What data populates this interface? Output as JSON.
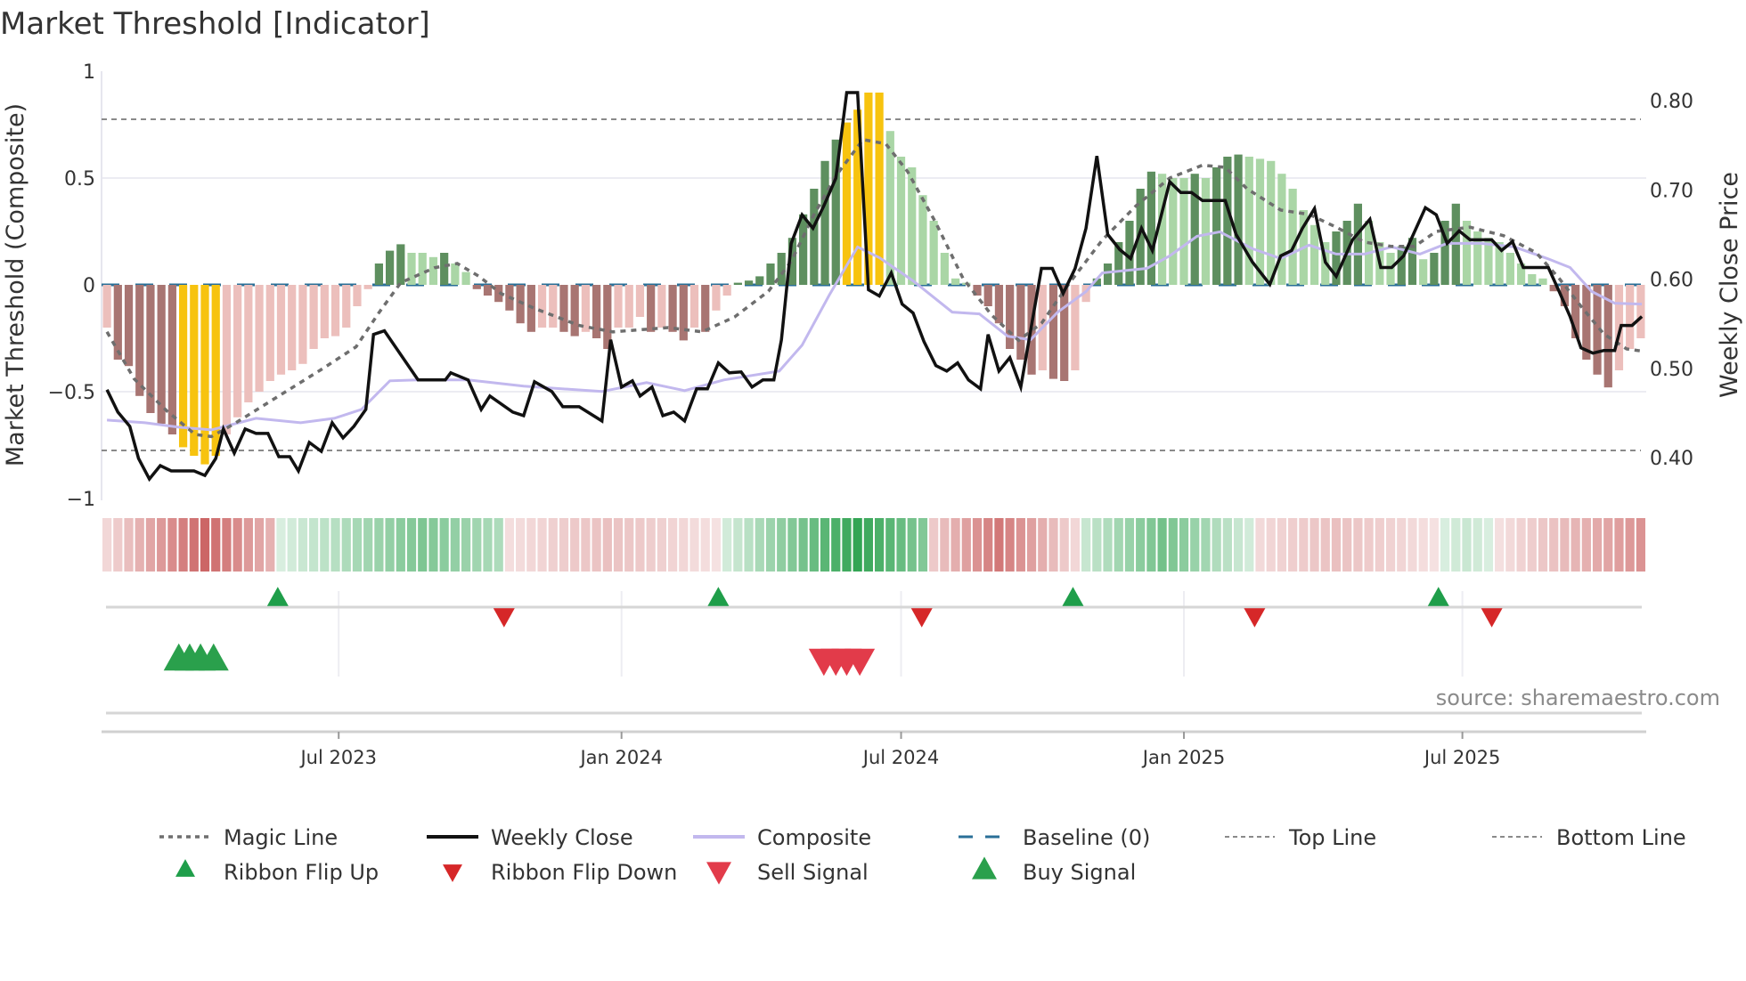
{
  "chart_data": {
    "type": "bar",
    "title": "Market Threshold [Indicator]",
    "ylabel": "Market Threshold (Composite)",
    "y2label": "Weekly Close Price",
    "ylim": [
      -1,
      1
    ],
    "y2lim": [
      0.4,
      0.8
    ],
    "yticks": [
      {
        "v": 1,
        "label": "1"
      },
      {
        "v": 0.5,
        "label": "0.5"
      },
      {
        "v": 0,
        "label": "0"
      },
      {
        "v": -0.5,
        "label": "−0.5"
      },
      {
        "v": -1,
        "label": "−1"
      }
    ],
    "y2ticks": [
      {
        "v": 0.8,
        "label": "0.80"
      },
      {
        "v": 0.7,
        "label": "0.70"
      },
      {
        "v": 0.6,
        "label": "0.60"
      },
      {
        "v": 0.5,
        "label": "0.50"
      },
      {
        "v": 0.4,
        "label": "0.40"
      }
    ],
    "x_unit": "week index",
    "n_weeks": 142,
    "xticks": [
      {
        "week": 21.8,
        "label": "Jul 2023"
      },
      {
        "week": 47.8,
        "label": "Jan 2024"
      },
      {
        "week": 73.5,
        "label": "Jul 2024"
      },
      {
        "week": 99.5,
        "label": "Jan 2025"
      },
      {
        "week": 125.1,
        "label": "Jul 2025"
      }
    ],
    "top_line": 0.775,
    "bottom_line": -0.775,
    "baseline": 0,
    "grid": true,
    "legend_position": "bottom",
    "composite_bars": [
      -0.2,
      -0.35,
      -0.38,
      -0.52,
      -0.6,
      -0.65,
      -0.7,
      -0.76,
      -0.8,
      -0.84,
      -0.8,
      -0.7,
      -0.62,
      -0.55,
      -0.5,
      -0.45,
      -0.42,
      -0.4,
      -0.37,
      -0.3,
      -0.25,
      -0.24,
      -0.2,
      -0.1,
      -0.02,
      0.1,
      0.16,
      0.19,
      0.15,
      0.15,
      0.13,
      0.15,
      0.1,
      0.06,
      -0.02,
      -0.05,
      -0.08,
      -0.12,
      -0.18,
      -0.22,
      -0.2,
      -0.2,
      -0.22,
      -0.24,
      -0.22,
      -0.25,
      -0.3,
      -0.2,
      -0.2,
      -0.15,
      -0.22,
      -0.2,
      -0.22,
      -0.26,
      -0.2,
      -0.22,
      -0.12,
      -0.05,
      0.01,
      0.02,
      0.04,
      0.1,
      0.15,
      0.22,
      0.33,
      0.45,
      0.58,
      0.68,
      0.76,
      0.82,
      0.9,
      0.9,
      0.72,
      0.6,
      0.55,
      0.42,
      0.3,
      0.15,
      0.03,
      0.01,
      -0.05,
      -0.1,
      -0.18,
      -0.3,
      -0.35,
      -0.42,
      -0.4,
      -0.44,
      -0.45,
      -0.4,
      -0.08,
      0.03,
      0.1,
      0.2,
      0.3,
      0.45,
      0.53,
      0.52,
      0.5,
      0.5,
      0.52,
      0.5,
      0.55,
      0.6,
      0.61,
      0.6,
      0.59,
      0.58,
      0.52,
      0.45,
      0.35,
      0.28,
      0.2,
      0.25,
      0.3,
      0.38,
      0.3,
      0.2,
      0.15,
      0.18,
      0.22,
      0.12,
      0.15,
      0.3,
      0.38,
      0.3,
      0.25,
      0.22,
      0.2,
      0.15,
      0.1,
      0.05,
      0.03,
      -0.03,
      -0.1,
      -0.25,
      -0.35,
      -0.42,
      -0.48,
      -0.4,
      -0.3,
      -0.25
    ],
    "weekly_close": [
      [
        0.5,
        0.476
      ],
      [
        1.5,
        0.451
      ],
      [
        2.6,
        0.435
      ],
      [
        3.4,
        0.399
      ],
      [
        4.4,
        0.376
      ],
      [
        5.4,
        0.391
      ],
      [
        6.4,
        0.385
      ],
      [
        8.5,
        0.385
      ],
      [
        9.5,
        0.38
      ],
      [
        10.5,
        0.399
      ],
      [
        11.2,
        0.432
      ],
      [
        12.2,
        0.405
      ],
      [
        13.2,
        0.432
      ],
      [
        14.2,
        0.427
      ],
      [
        15.3,
        0.427
      ],
      [
        16.3,
        0.401
      ],
      [
        17.3,
        0.401
      ],
      [
        18.1,
        0.385
      ],
      [
        19.1,
        0.417
      ],
      [
        20.2,
        0.407
      ],
      [
        21.2,
        0.439
      ],
      [
        22.2,
        0.422
      ],
      [
        23.2,
        0.435
      ],
      [
        24.3,
        0.454
      ],
      [
        25.0,
        0.538
      ],
      [
        26.0,
        0.542
      ],
      [
        29.1,
        0.487
      ],
      [
        31.6,
        0.487
      ],
      [
        32.1,
        0.495
      ],
      [
        33.7,
        0.487
      ],
      [
        34.9,
        0.454
      ],
      [
        35.7,
        0.469
      ],
      [
        37.8,
        0.451
      ],
      [
        38.8,
        0.447
      ],
      [
        39.8,
        0.485
      ],
      [
        41.4,
        0.474
      ],
      [
        42.4,
        0.457
      ],
      [
        43.9,
        0.457
      ],
      [
        46.0,
        0.441
      ],
      [
        46.8,
        0.532
      ],
      [
        47.8,
        0.479
      ],
      [
        48.8,
        0.486
      ],
      [
        49.5,
        0.469
      ],
      [
        50.6,
        0.479
      ],
      [
        51.6,
        0.447
      ],
      [
        52.6,
        0.451
      ],
      [
        53.6,
        0.441
      ],
      [
        54.7,
        0.477
      ],
      [
        55.7,
        0.477
      ],
      [
        56.7,
        0.506
      ],
      [
        57.7,
        0.495
      ],
      [
        58.8,
        0.496
      ],
      [
        59.8,
        0.479
      ],
      [
        60.8,
        0.487
      ],
      [
        61.8,
        0.487
      ],
      [
        62.5,
        0.532
      ],
      [
        63.4,
        0.64
      ],
      [
        64.4,
        0.672
      ],
      [
        65.4,
        0.657
      ],
      [
        66.4,
        0.682
      ],
      [
        67.5,
        0.713
      ],
      [
        68.5,
        0.809
      ],
      [
        69.5,
        0.809
      ],
      [
        70.5,
        0.588
      ],
      [
        71.5,
        0.581
      ],
      [
        72.6,
        0.607
      ],
      [
        73.6,
        0.572
      ],
      [
        74.6,
        0.562
      ],
      [
        75.6,
        0.53
      ],
      [
        76.7,
        0.503
      ],
      [
        77.7,
        0.497
      ],
      [
        78.7,
        0.506
      ],
      [
        79.7,
        0.487
      ],
      [
        80.8,
        0.477
      ],
      [
        81.5,
        0.538
      ],
      [
        82.5,
        0.497
      ],
      [
        83.5,
        0.512
      ],
      [
        84.5,
        0.479
      ],
      [
        86.4,
        0.612
      ],
      [
        87.4,
        0.612
      ],
      [
        88.4,
        0.584
      ],
      [
        89.5,
        0.612
      ],
      [
        90.5,
        0.657
      ],
      [
        91.5,
        0.738
      ],
      [
        92.5,
        0.65
      ],
      [
        93.6,
        0.633
      ],
      [
        94.6,
        0.623
      ],
      [
        95.6,
        0.657
      ],
      [
        96.6,
        0.632
      ],
      [
        98.2,
        0.709
      ],
      [
        99.2,
        0.697
      ],
      [
        100.2,
        0.697
      ],
      [
        101.2,
        0.688
      ],
      [
        103.3,
        0.688
      ],
      [
        104.3,
        0.65
      ],
      [
        105.8,
        0.619
      ],
      [
        107.4,
        0.594
      ],
      [
        108.4,
        0.626
      ],
      [
        109.4,
        0.632
      ],
      [
        110.4,
        0.657
      ],
      [
        111.5,
        0.679
      ],
      [
        112.5,
        0.619
      ],
      [
        113.5,
        0.603
      ],
      [
        115.0,
        0.644
      ],
      [
        116.6,
        0.667
      ],
      [
        117.6,
        0.613
      ],
      [
        118.6,
        0.613
      ],
      [
        119.7,
        0.626
      ],
      [
        121.7,
        0.68
      ],
      [
        122.7,
        0.672
      ],
      [
        123.7,
        0.64
      ],
      [
        124.8,
        0.654
      ],
      [
        125.8,
        0.644
      ],
      [
        127.8,
        0.644
      ],
      [
        128.7,
        0.632
      ],
      [
        129.7,
        0.642
      ],
      [
        130.7,
        0.613
      ],
      [
        133.0,
        0.613
      ],
      [
        134.0,
        0.586
      ],
      [
        135.0,
        0.558
      ],
      [
        136.0,
        0.523
      ],
      [
        137.1,
        0.517
      ],
      [
        138.1,
        0.52
      ],
      [
        139.1,
        0.52
      ],
      [
        139.7,
        0.548
      ],
      [
        140.7,
        0.548
      ],
      [
        141.6,
        0.558
      ]
    ],
    "magic_line": [
      [
        0.5,
        -0.22
      ],
      [
        3,
        -0.44
      ],
      [
        6,
        -0.59
      ],
      [
        8.6,
        -0.7
      ],
      [
        10.1,
        -0.71
      ],
      [
        12.2,
        -0.65
      ],
      [
        16.3,
        -0.52
      ],
      [
        20.4,
        -0.39
      ],
      [
        23.4,
        -0.29
      ],
      [
        25.5,
        -0.13
      ],
      [
        27.5,
        0.01
      ],
      [
        30.6,
        0.08
      ],
      [
        32.7,
        0.1
      ],
      [
        34.7,
        0.04
      ],
      [
        36.7,
        -0.04
      ],
      [
        39.8,
        -0.11
      ],
      [
        43.9,
        -0.19
      ],
      [
        47,
        -0.22
      ],
      [
        52.1,
        -0.2
      ],
      [
        55.2,
        -0.22
      ],
      [
        58.2,
        -0.15
      ],
      [
        61.3,
        -0.03
      ],
      [
        63.4,
        0.11
      ],
      [
        65.4,
        0.32
      ],
      [
        67.5,
        0.51
      ],
      [
        70,
        0.68
      ],
      [
        72.1,
        0.66
      ],
      [
        74.1,
        0.53
      ],
      [
        76.7,
        0.29
      ],
      [
        79.2,
        0.03
      ],
      [
        81.8,
        -0.14
      ],
      [
        84.3,
        -0.26
      ],
      [
        86.4,
        -0.18
      ],
      [
        89,
        0.01
      ],
      [
        92,
        0.21
      ],
      [
        95.1,
        0.37
      ],
      [
        98.2,
        0.5
      ],
      [
        101.2,
        0.56
      ],
      [
        103.3,
        0.55
      ],
      [
        105.3,
        0.45
      ],
      [
        108.4,
        0.35
      ],
      [
        111,
        0.33
      ],
      [
        113.5,
        0.27
      ],
      [
        116.1,
        0.2
      ],
      [
        118.6,
        0.18
      ],
      [
        120.7,
        0.18
      ],
      [
        122.7,
        0.25
      ],
      [
        125.8,
        0.27
      ],
      [
        128.9,
        0.23
      ],
      [
        131.9,
        0.15
      ],
      [
        134,
        0.03
      ],
      [
        136,
        -0.1
      ],
      [
        138.1,
        -0.23
      ],
      [
        140.2,
        -0.3
      ],
      [
        141.6,
        -0.31
      ]
    ],
    "composite_line": [
      [
        0.5,
        0.442
      ],
      [
        4,
        0.439
      ],
      [
        7.1,
        0.434
      ],
      [
        10.1,
        0.431
      ],
      [
        14.2,
        0.444
      ],
      [
        18.3,
        0.439
      ],
      [
        21.4,
        0.444
      ],
      [
        23.9,
        0.454
      ],
      [
        26.5,
        0.486
      ],
      [
        29.1,
        0.487
      ],
      [
        33.7,
        0.487
      ],
      [
        38.8,
        0.48
      ],
      [
        46,
        0.474
      ],
      [
        50.1,
        0.484
      ],
      [
        53.6,
        0.475
      ],
      [
        57.2,
        0.487
      ],
      [
        62.3,
        0.497
      ],
      [
        64.4,
        0.526
      ],
      [
        66.9,
        0.582
      ],
      [
        69.5,
        0.636
      ],
      [
        71.5,
        0.624
      ],
      [
        74.6,
        0.598
      ],
      [
        78.2,
        0.563
      ],
      [
        80.7,
        0.561
      ],
      [
        83.3,
        0.536
      ],
      [
        85.4,
        0.532
      ],
      [
        87.9,
        0.563
      ],
      [
        90.5,
        0.586
      ],
      [
        92,
        0.607
      ],
      [
        96.1,
        0.612
      ],
      [
        98.2,
        0.626
      ],
      [
        100.7,
        0.648
      ],
      [
        102.8,
        0.653
      ],
      [
        105.8,
        0.634
      ],
      [
        108.4,
        0.623
      ],
      [
        111,
        0.638
      ],
      [
        113.5,
        0.628
      ],
      [
        116.1,
        0.628
      ],
      [
        118.6,
        0.636
      ],
      [
        121.2,
        0.628
      ],
      [
        123.7,
        0.64
      ],
      [
        126.8,
        0.64
      ],
      [
        129.9,
        0.636
      ],
      [
        132.9,
        0.623
      ],
      [
        135,
        0.613
      ],
      [
        137,
        0.586
      ],
      [
        139.1,
        0.573
      ],
      [
        141.6,
        0.572
      ]
    ],
    "ribbon_segments": [
      {
        "from": 0,
        "to": 15,
        "sign": -1,
        "peak_week": 9,
        "peak": 0.85
      },
      {
        "from": 16,
        "to": 36,
        "sign": 1,
        "peak_week": 29,
        "peak": 0.6
      },
      {
        "from": 37,
        "to": 56,
        "sign": -1,
        "peak_week": 46,
        "peak": 0.35
      },
      {
        "from": 57,
        "to": 75,
        "sign": 1,
        "peak_week": 69,
        "peak": 0.95
      },
      {
        "from": 76,
        "to": 89,
        "sign": -1,
        "peak_week": 82,
        "peak": 0.75
      },
      {
        "from": 90,
        "to": 105,
        "sign": 1,
        "peak_week": 97,
        "peak": 0.65
      },
      {
        "from": 106,
        "to": 122,
        "sign": -1,
        "peak_week": 113,
        "peak": 0.35
      },
      {
        "from": 123,
        "to": 127,
        "sign": 1,
        "peak_week": 125,
        "peak": 0.25
      },
      {
        "from": 128,
        "to": 141,
        "sign": -1,
        "peak_week": 141,
        "peak": 0.6
      }
    ],
    "ribbon_flip_up": [
      16.2,
      56.7,
      89.3,
      122.9
    ],
    "ribbon_flip_down": [
      37.0,
      75.4,
      106.0,
      127.8
    ],
    "buy_signals": [
      7.1,
      8.1,
      9.1,
      10.3
    ],
    "sell_signals": [
      66.4,
      67.5,
      68.5,
      69.7
    ],
    "legend": [
      {
        "key": "magic",
        "label": "Magic Line"
      },
      {
        "key": "close",
        "label": "Weekly Close"
      },
      {
        "key": "composite",
        "label": "Composite"
      },
      {
        "key": "baseline",
        "label": "Baseline (0)"
      },
      {
        "key": "top",
        "label": "Top Line"
      },
      {
        "key": "bottom",
        "label": "Bottom Line"
      },
      {
        "key": "flipup",
        "label": "Ribbon Flip Up"
      },
      {
        "key": "flipdown",
        "label": "Ribbon Flip Down"
      },
      {
        "key": "sell",
        "label": "Sell Signal"
      },
      {
        "key": "buy",
        "label": "Buy Signal"
      }
    ],
    "colors": {
      "bar_dark_green": "#5e8f5f",
      "bar_light_green": "#aad6a6",
      "bar_dark_red": "#a87572",
      "bar_light_red": "#ecbfbc",
      "bar_extreme": "#f7c30f",
      "close": "#111111",
      "magic": "#6e6e6e",
      "composite": "#c2b8ee",
      "baseline": "#2a6f97",
      "ref_lines": "#8a8a8a",
      "flip_up": "#1f9e4a",
      "flip_down": "#d62728",
      "sell": "#e23b4a",
      "buy": "#2aa04c"
    }
  },
  "source": "source: sharemaestro.com"
}
